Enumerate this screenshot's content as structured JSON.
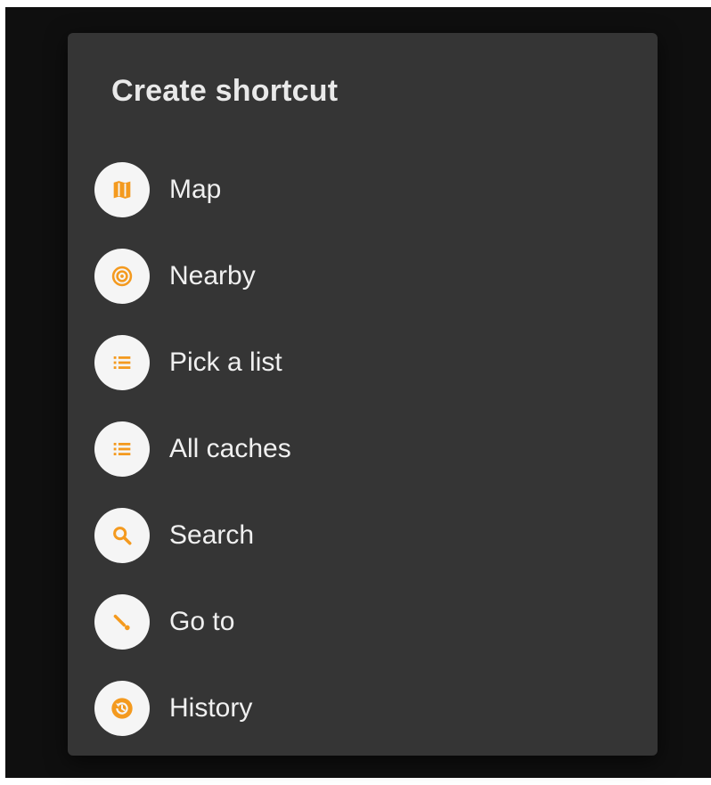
{
  "colors": {
    "accent": "#f49a1f",
    "dialog_bg": "#353535",
    "screen_bg": "#0f0f0f",
    "icon_bg": "#f5f5f5"
  },
  "dialog": {
    "title": "Create shortcut",
    "items": [
      {
        "label": "Map",
        "icon": "map-icon"
      },
      {
        "label": "Nearby",
        "icon": "nearby-icon"
      },
      {
        "label": "Pick a list",
        "icon": "list-icon"
      },
      {
        "label": "All caches",
        "icon": "list-icon"
      },
      {
        "label": "Search",
        "icon": "search-icon"
      },
      {
        "label": "Go to",
        "icon": "goto-icon"
      },
      {
        "label": "History",
        "icon": "history-icon"
      }
    ]
  }
}
